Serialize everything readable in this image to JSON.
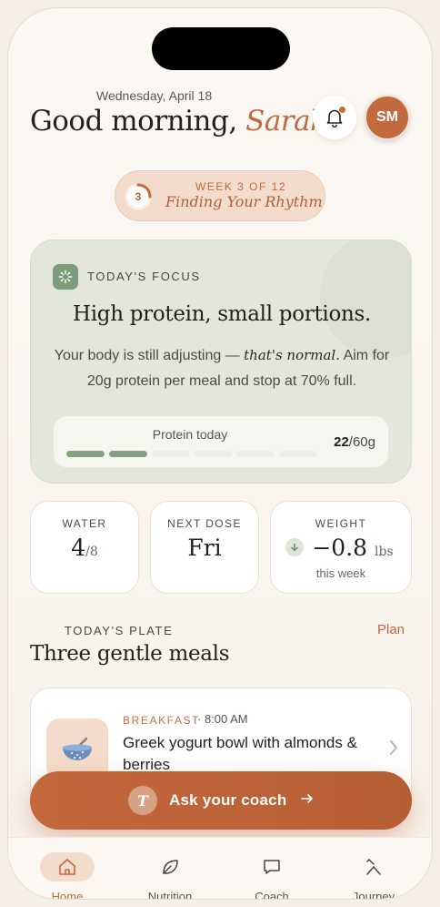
{
  "header": {
    "date": "Wednesday, April 18",
    "greeting": "Good morning,",
    "name": "Sarah",
    "avatar_initials": "SM",
    "notification_badge": true
  },
  "program": {
    "week_current": "3",
    "week_label": "WEEK 3 OF 12",
    "phase_title": "Finding Your Rhythm",
    "progress_fraction": 0.25
  },
  "focus": {
    "label": "TODAY'S FOCUS",
    "heading": "High protein, small portions.",
    "body_before": "Your body is still adjusting — ",
    "body_emphasis": "that's normal.",
    "body_after": " Aim for 20g protein per meal and stop at 70% full.",
    "protein_label": "Protein today",
    "protein_current": "22",
    "protein_goal": "/60g",
    "protein_segments_filled": 2,
    "protein_segments_total": 6
  },
  "stats": {
    "water": {
      "label": "WATER",
      "value": "4",
      "unit": "/8"
    },
    "next_dose": {
      "label": "NEXT DOSE",
      "value": "Fri"
    },
    "weight": {
      "label": "WEIGHT",
      "value": "−0.8",
      "unit": "lbs",
      "sub": "this week"
    }
  },
  "plate": {
    "label": "TODAY'S PLATE",
    "title": "Three gentle meals",
    "plan_link": "Plan",
    "meals": [
      {
        "type": "BREAKFAST",
        "time": "· 8:00 AM",
        "name": "Greek yogurt bowl with almonds & berries"
      }
    ]
  },
  "coach_button": {
    "avatar_letter": "T",
    "label": "Ask your coach"
  },
  "tabs": [
    {
      "label": "Home",
      "icon": "home-icon",
      "active": true
    },
    {
      "label": "Nutrition",
      "icon": "leaf-icon",
      "active": false
    },
    {
      "label": "Coach",
      "icon": "chat-icon",
      "active": false
    },
    {
      "label": "Journey",
      "icon": "path-icon",
      "active": false
    }
  ],
  "colors": {
    "accent": "#c06a3e",
    "sage": "#86a181",
    "background": "#f7f1ea"
  }
}
